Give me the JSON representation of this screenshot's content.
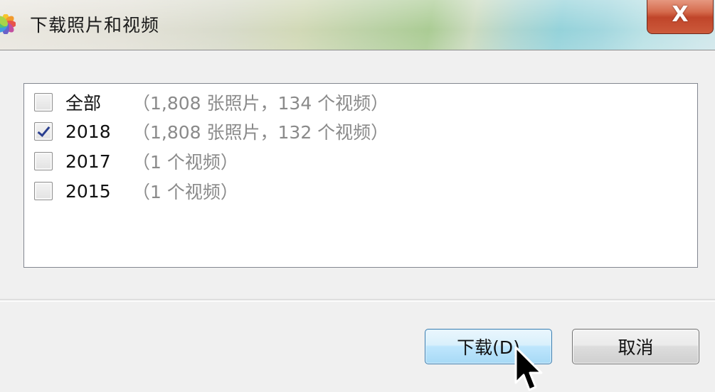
{
  "window": {
    "title": "下载照片和视频",
    "close_label": "X"
  },
  "list": {
    "items": [
      {
        "label": "全部",
        "detail": "（1,808 张照片，134 个视频）",
        "checked": false
      },
      {
        "label": "2018",
        "detail": "（1,808 张照片，132 个视频）",
        "checked": true
      },
      {
        "label": "2017",
        "detail": "（1 个视频）",
        "checked": false
      },
      {
        "label": "2015",
        "detail": "（1 个视频）",
        "checked": false
      }
    ]
  },
  "buttons": {
    "download_label": "下载(D)",
    "cancel_label": "取消"
  },
  "icons": {
    "app": "photos-flower-icon",
    "close": "close-icon",
    "cursor": "mouse-pointer-icon"
  },
  "colors": {
    "close_button": "#c94a2e",
    "detail_text": "#8a8a8a",
    "default_button_border": "#3c7fb1"
  }
}
